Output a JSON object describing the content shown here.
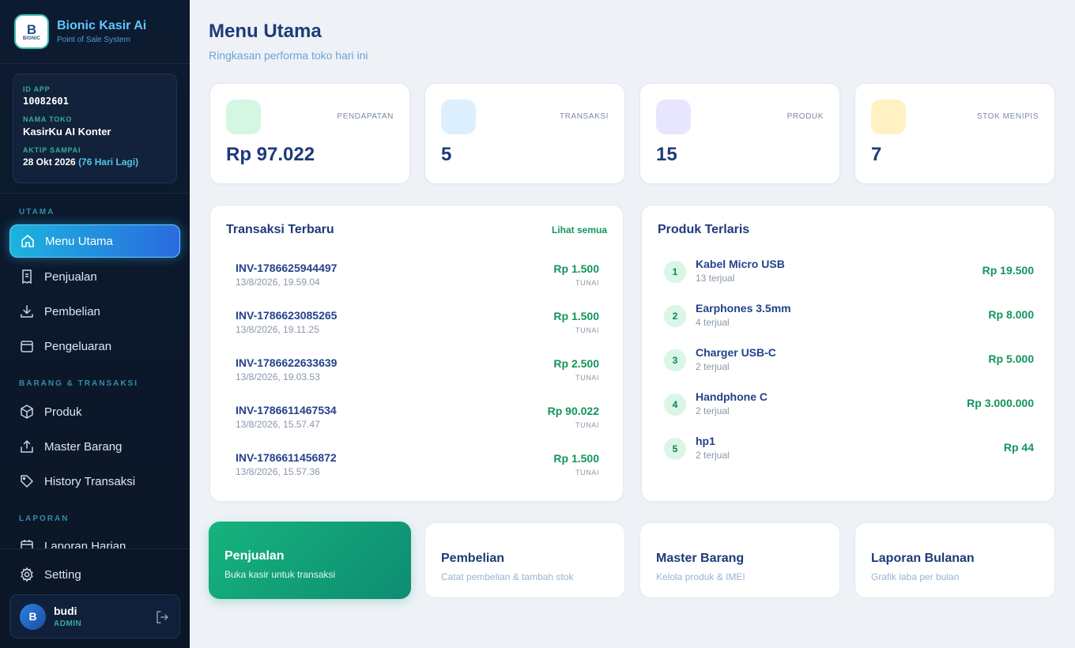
{
  "brand": {
    "logo_text": "B",
    "logo_sub": "BIONIC",
    "title": "Bionic Kasir Ai",
    "subtitle": "Point of Sale System"
  },
  "account": {
    "id_label": "ID APP",
    "id_value": "10082601",
    "store_label": "NAMA TOKO",
    "store_value": "KasirKu AI Konter",
    "active_label": "AKTIP SAMPAI",
    "active_date": "28 Okt 2026",
    "active_remaining": "(76 Hari Lagi)"
  },
  "sidebar": {
    "sections": {
      "utama": "UTAMA",
      "barang": "BARANG & TRANSAKSI",
      "laporan": "LAPORAN"
    },
    "items": [
      {
        "label": "Menu Utama",
        "icon": "home-icon"
      },
      {
        "label": "Penjualan",
        "icon": "receipt-icon"
      },
      {
        "label": "Pembelian",
        "icon": "download-icon"
      },
      {
        "label": "Pengeluaran",
        "icon": "wallet-icon"
      },
      {
        "label": "Produk",
        "icon": "box-icon"
      },
      {
        "label": "Master Barang",
        "icon": "upload-box-icon"
      },
      {
        "label": "History Transaksi",
        "icon": "tag-icon"
      },
      {
        "label": "Laporan Harian",
        "icon": "calendar-icon"
      },
      {
        "label": "Setting",
        "icon": "gear-icon"
      }
    ]
  },
  "user": {
    "initial": "B",
    "name": "budi",
    "role": "ADMIN"
  },
  "header": {
    "title": "Menu Utama",
    "subtitle": "Ringkasan performa toko hari ini"
  },
  "stats": [
    {
      "label": "PENDAPATAN",
      "value": "Rp 97.022",
      "color": "#d3f7e3"
    },
    {
      "label": "TRANSAKSI",
      "value": "5",
      "color": "#dcefff"
    },
    {
      "label": "PRODUK",
      "value": "15",
      "color": "#e8e6ff"
    },
    {
      "label": "STOK MENIPIS",
      "value": "7",
      "color": "#fff1c2"
    }
  ],
  "transactions": {
    "title": "Transaksi Terbaru",
    "see_all": "Lihat semua",
    "rows": [
      {
        "id": "INV-1786625944497",
        "date": "13/8/2026, 19.59.04",
        "amount": "Rp 1.500",
        "method": "TUNAI"
      },
      {
        "id": "INV-1786623085265",
        "date": "13/8/2026, 19.11.25",
        "amount": "Rp 1.500",
        "method": "TUNAI"
      },
      {
        "id": "INV-1786622633639",
        "date": "13/8/2026, 19.03.53",
        "amount": "Rp 2.500",
        "method": "TUNAI"
      },
      {
        "id": "INV-1786611467534",
        "date": "13/8/2026, 15.57.47",
        "amount": "Rp 90.022",
        "method": "TUNAI"
      },
      {
        "id": "INV-1786611456872",
        "date": "13/8/2026, 15.57.36",
        "amount": "Rp 1.500",
        "method": "TUNAI"
      }
    ]
  },
  "bestsellers": {
    "title": "Produk Terlaris",
    "rows": [
      {
        "rank": "1",
        "name": "Kabel Micro USB",
        "sold": "13 terjual",
        "amount": "Rp 19.500"
      },
      {
        "rank": "2",
        "name": "Earphones 3.5mm",
        "sold": "4 terjual",
        "amount": "Rp 8.000"
      },
      {
        "rank": "3",
        "name": "Charger USB-C",
        "sold": "2 terjual",
        "amount": "Rp 5.000"
      },
      {
        "rank": "4",
        "name": "Handphone C",
        "sold": "2 terjual",
        "amount": "Rp 3.000.000"
      },
      {
        "rank": "5",
        "name": "hp1",
        "sold": "2 terjual",
        "amount": "Rp 44"
      }
    ]
  },
  "quick_actions": [
    {
      "title": "Penjualan",
      "subtitle": "Buka kasir untuk transaksi"
    },
    {
      "title": "Pembelian",
      "subtitle": "Catat pembelian & tambah stok"
    },
    {
      "title": "Master Barang",
      "subtitle": "Kelola produk & IMEI"
    },
    {
      "title": "Laporan Bulanan",
      "subtitle": "Grafik laba per bulan"
    }
  ]
}
